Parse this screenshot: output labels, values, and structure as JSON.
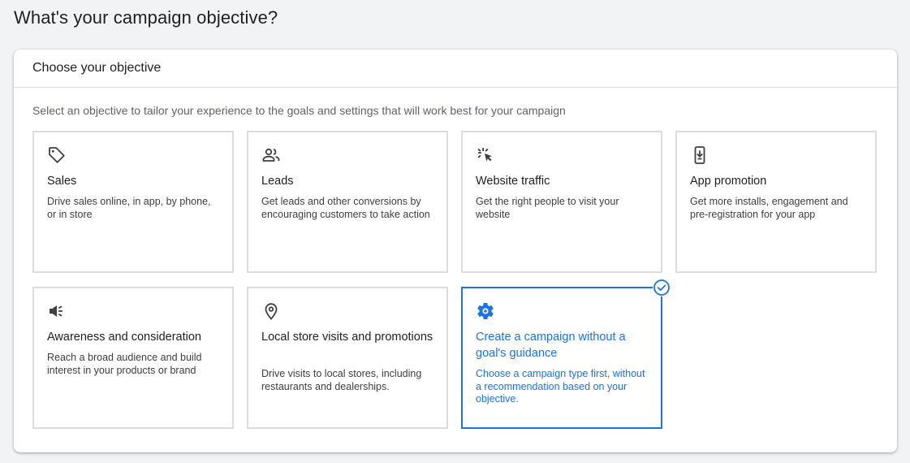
{
  "page": {
    "title": "What's your campaign objective?"
  },
  "panel": {
    "header": "Choose your objective",
    "description": "Select an objective to tailor your experience to the goals and settings that will work best for your campaign"
  },
  "objectives": [
    {
      "title": "Sales",
      "description": "Drive sales online, in app, by phone, or in store",
      "icon": "tag-icon"
    },
    {
      "title": "Leads",
      "description": "Get leads and other conversions by encouraging customers to take action",
      "icon": "people-icon"
    },
    {
      "title": "Website traffic",
      "description": "Get the right people to visit your website",
      "icon": "cursor-click-icon"
    },
    {
      "title": "App promotion",
      "description": "Get more installs, engagement and pre-registration for your app",
      "icon": "phone-download-icon"
    },
    {
      "title": "Awareness and consideration",
      "description": "Reach a broad audience and build interest in your products or brand",
      "icon": "megaphone-icon"
    },
    {
      "title": "Local store visits and promotions",
      "description": "Drive visits to local stores, including restaurants and dealerships.",
      "icon": "location-pin-icon"
    },
    {
      "title": "Create a campaign without a goal's guidance",
      "description": "Choose a campaign type first, without a recommendation based on your objective.",
      "icon": "gear-icon",
      "selected": true
    }
  ],
  "colors": {
    "accent": "#1a73e8",
    "border": "#dadce0",
    "background": "#f1f3f4"
  }
}
